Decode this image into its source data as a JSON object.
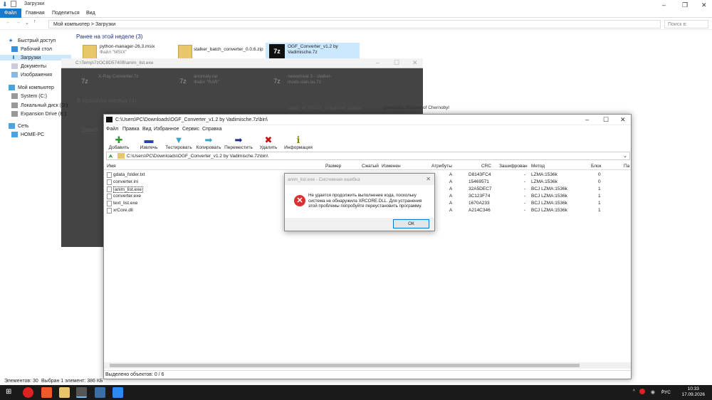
{
  "explorer": {
    "title": "Загрузки",
    "ribbon": {
      "file": "Файл",
      "tabs": [
        "Главная",
        "Поделиться",
        "Вид"
      ]
    },
    "address": {
      "path": [
        "Мой компьютер",
        "Загрузки"
      ],
      "sep": ">",
      "search_placeholder": "Поиск в:"
    },
    "nav": {
      "quick": "Быстрый доступ",
      "desktop": "Рабочий стол",
      "downloads": "Загрузки",
      "documents": "Документы",
      "images": "Изображения",
      "computer": "Мой компьютер",
      "system": "System (C:)",
      "local": "Локальный диск (D:)",
      "expansion": "Expansion Drive (E:)",
      "network": "Сеть",
      "home": "HOME-PC"
    },
    "groups": {
      "this_week": "Ранее на этой неделе (3)",
      "last_month": "В прошлом месяце (4)",
      "earlier": "Давно"
    },
    "files": {
      "f1": {
        "name": "python-manager-26.3.msix",
        "type": "Файл \"MSIX\""
      },
      "f2": {
        "name": "stalker_batch_converter_0.0.6.zip"
      },
      "f3": {
        "name": "OGF_Converter_v1.2 by Vadimische.7z"
      },
      "f4": {
        "name": "X-Ray Converter.7z"
      },
      "f5": {
        "name": "anomaly.rar",
        "type": "Файл \"RAR\""
      },
      "f6": {
        "name": "newsmeat 3 - stalker-mods.clan.su.7z"
      },
      "f7": {
        "name": "setup_of_STALX_enhanced_edition"
      },
      "f8": {
        "name": "gamedata Shadow of Chernobyl"
      }
    },
    "status": {
      "items": "Элементов: 30",
      "selected": "Выбран 1 элемент: 386 КБ"
    }
  },
  "dark_window": {
    "title": "C:\\Temp\\7zOC8D5740B\\anim_list.exe"
  },
  "sevenzip": {
    "title": "C:\\Users\\PC\\Downloads\\OGF_Converter_v1.2 by Vadimische.7z\\bin\\",
    "menu": [
      "Файл",
      "Правка",
      "Вид",
      "Избранное",
      "Сервис",
      "Справка"
    ],
    "toolbar": [
      {
        "label": "Добавить",
        "glyph": "✚",
        "color": "#2b9a2b"
      },
      {
        "label": "Извлечь",
        "glyph": "▬",
        "color": "#2244aa"
      },
      {
        "label": "Тестировать",
        "glyph": "▼",
        "color": "#3aa5c8"
      },
      {
        "label": "Копировать",
        "glyph": "➡",
        "color": "#3aa5c8"
      },
      {
        "label": "Переместить",
        "glyph": "➡",
        "color": "#1e2b8a"
      },
      {
        "label": "Удалить",
        "glyph": "✖",
        "color": "#cc1111"
      },
      {
        "label": "Информация",
        "glyph": "ℹ",
        "color": "#888800"
      }
    ],
    "path": "C:\\Users\\PC\\Downloads\\OGF_Converter_v1.2 by Vadimische.7z\\bin\\",
    "columns": [
      "Имя",
      "Размер",
      "Сжатый",
      "Изменен",
      "Атрибуты",
      "CRC",
      "Зашифрован",
      "Метод",
      "Блок",
      "Па"
    ],
    "rows": [
      {
        "name": "gdata_folder.txt",
        "attr": "A",
        "crc": "D8143FC4",
        "enc": "-",
        "method": "LZMA:1536k",
        "block": "0"
      },
      {
        "name": "converter.ini",
        "attr": "A",
        "crc": "15469571",
        "enc": "-",
        "method": "LZMA:1536k",
        "block": "0"
      },
      {
        "name": "anim_list.exe",
        "attr": "A",
        "crc": "32A5DEC7",
        "enc": "-",
        "method": "BCJ LZMA:1536k",
        "block": "1"
      },
      {
        "name": "converter.exe",
        "attr": "A",
        "crc": "3C123F74",
        "enc": "-",
        "method": "BCJ LZMA:1536k",
        "block": "1"
      },
      {
        "name": "text_list.exe",
        "attr": "A",
        "crc": "1670A233",
        "enc": "-",
        "method": "BCJ LZMA:1536k",
        "block": "1"
      },
      {
        "name": "xrCore.dll",
        "attr": "A",
        "crc": "A214C346",
        "enc": "-",
        "method": "BCJ LZMA:1536k",
        "block": "1"
      }
    ],
    "status": "Выделено объектов: 0 / 6"
  },
  "error": {
    "title": "anim_list.exe - Системная ошибка",
    "message": "Не удается продолжить выполнение кода, поскольку система не обнаружила XRCORE.DLL. Для устранения этой проблемы попробуйте переустановить программу.",
    "ok": "ОК"
  },
  "taskbar": {
    "lang": "РУС",
    "time": "10:33",
    "date": "17.09.2026"
  }
}
